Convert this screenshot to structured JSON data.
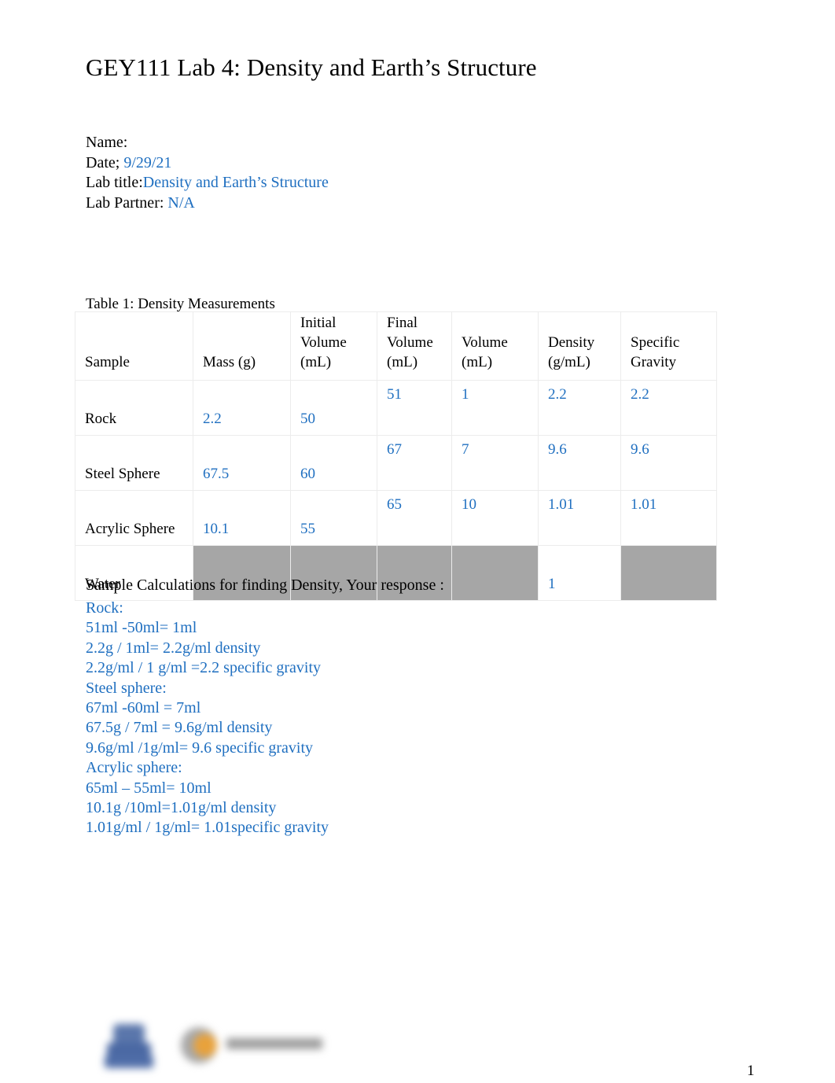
{
  "document": {
    "title": "GEY111 Lab 4: Density and Earth’s Structure",
    "page_number": "1"
  },
  "header": {
    "name_label": "Name:",
    "name_value": "",
    "date_label": "Date;",
    "date_value": "9/29/21",
    "lab_title_label": "Lab title:",
    "lab_title_value": "Density and Earth’s Structure",
    "lab_partner_label": "Lab Partner:",
    "lab_partner_value": "N/A"
  },
  "table": {
    "caption": "Table 1: Density Measurements",
    "columns": [
      "Sample",
      "Mass (g)",
      "Initial Volume (mL)",
      "Final Volume (mL)",
      "Volume (mL)",
      "Density (g/mL)",
      "Specific Gravity"
    ],
    "column_lines": [
      [
        "Sample"
      ],
      [
        "Mass (g)"
      ],
      [
        "Initial",
        "Volume",
        "(mL)"
      ],
      [
        "Final",
        "Volume",
        "(mL)"
      ],
      [
        "Volume",
        "(mL)"
      ],
      [
        "Density",
        "(g/mL)"
      ],
      [
        "Specific",
        "Gravity"
      ]
    ],
    "rows": [
      {
        "sample": "Rock",
        "mass": "2.2",
        "initial_volume": "50",
        "final_volume": "51",
        "volume": "1",
        "density": "2.2",
        "specific_gravity": "2.2"
      },
      {
        "sample": "Steel Sphere",
        "mass": "67.5",
        "initial_volume": "60",
        "final_volume": "67",
        "volume": "7",
        "density": "9.6",
        "specific_gravity": "9.6"
      },
      {
        "sample": "Acrylic Sphere",
        "mass": "10.1",
        "initial_volume": "55",
        "final_volume": "65",
        "volume": "10",
        "density": "1.01",
        "specific_gravity": "1.01"
      },
      {
        "sample": "Water",
        "mass": "",
        "initial_volume": "",
        "final_volume": "",
        "volume": "",
        "density": "1",
        "specific_gravity": ""
      }
    ]
  },
  "calculations": {
    "intro": "Sample Calculations for finding Density, Your response  :",
    "lines": [
      "Rock:",
      "51ml -50ml= 1ml",
      "2.2g / 1ml= 2.2g/ml density",
      "2.2g/ml / 1 g/ml =2.2 specific gravity",
      "Steel sphere:",
      "67ml -60ml = 7ml",
      "67.5g / 7ml = 9.6g/ml density",
      "9.6g/ml /1g/ml= 9.6 specific gravity",
      "Acrylic sphere:",
      "65ml – 55ml= 10ml",
      "10.1g /10ml=1.01g/ml density",
      "1.01g/ml / 1g/ml= 1.01specific gravity"
    ]
  },
  "colors": {
    "filled_text_blue": "#1F6FC0",
    "shaded_cell_grey": "#A6A6A6",
    "table_border": "#ECECEC"
  }
}
